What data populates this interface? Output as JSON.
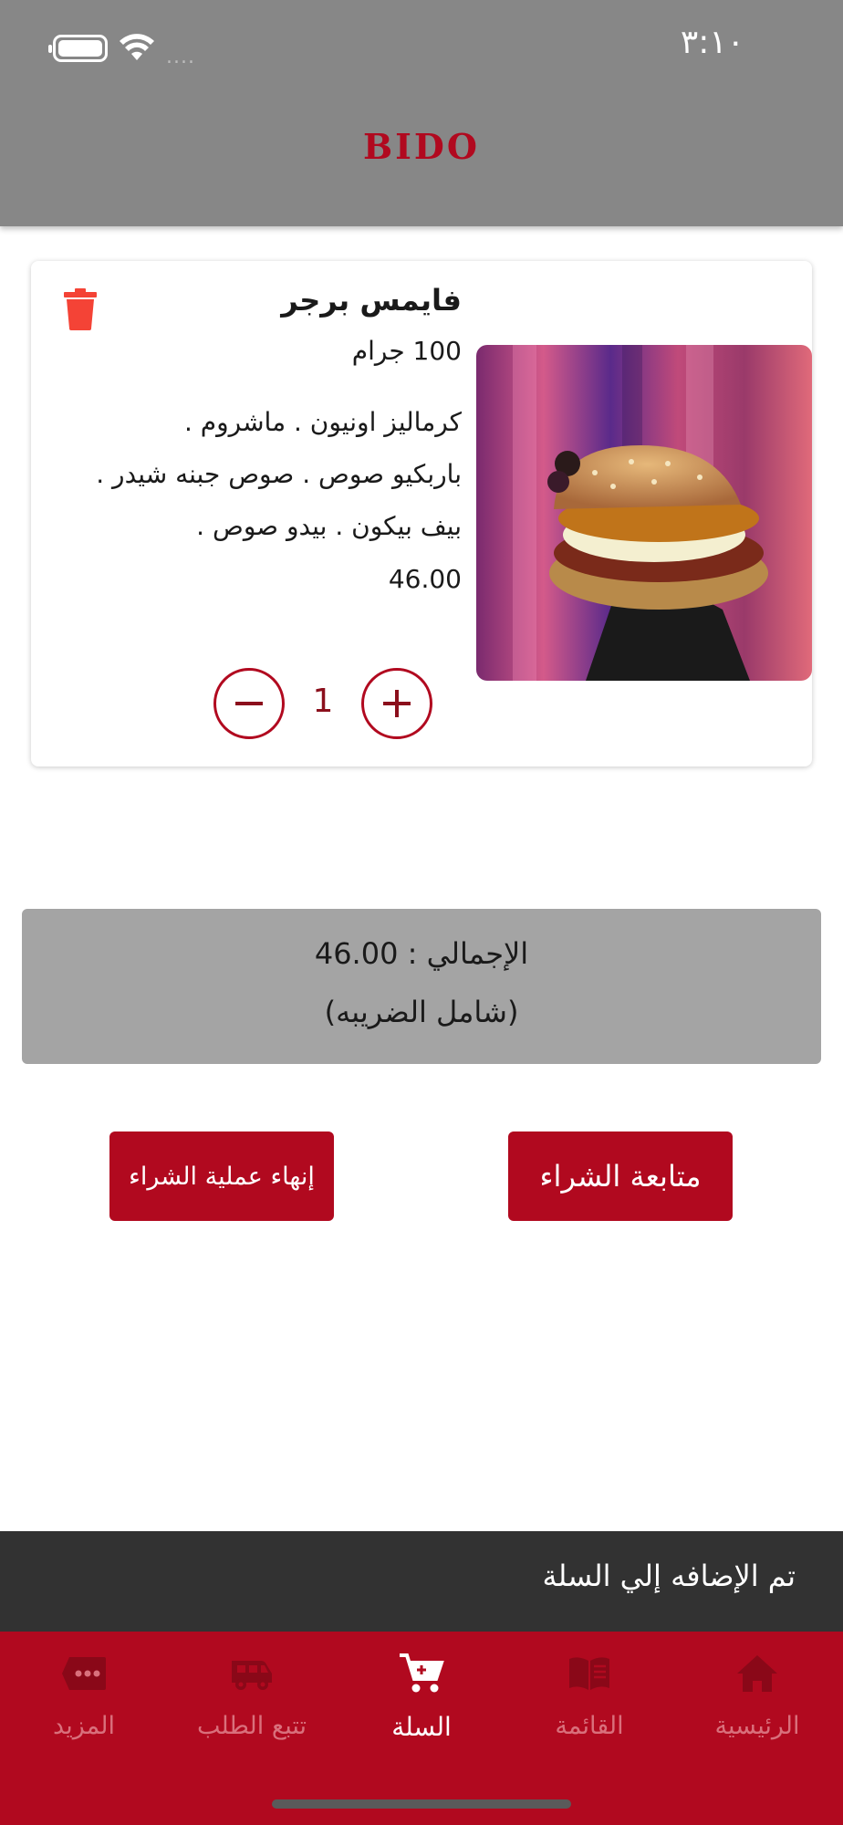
{
  "status_bar": {
    "time": "٣:١٠",
    "signal_dots": "....",
    "icons": [
      "battery-icon",
      "wifi-icon",
      "signal-icon"
    ]
  },
  "header": {
    "brand": "BIDO"
  },
  "cart": {
    "items": [
      {
        "name": "فايمس برجر",
        "weight": "100 جرام",
        "description_lines": [
          "كرماليز اونيون . ماشروم .",
          "باربكيو صوص . صوص جبنه شيدر .",
          "بيف بيكون . بيدو صوص ."
        ],
        "price": "46.00",
        "quantity": "1"
      }
    ]
  },
  "totals": {
    "total_label": "الإجمالي : 46.00",
    "tax_note": "(شامل الضريبه)"
  },
  "actions": {
    "finish_label": "إنهاء عملية الشراء",
    "continue_label": "متابعة الشراء"
  },
  "snackbar": {
    "message": "تم الإضافه إلي السلة"
  },
  "bottom_nav": {
    "items": [
      {
        "label": "المزيد",
        "icon": "more-icon",
        "active": false
      },
      {
        "label": "تتبع الطلب",
        "icon": "truck-icon",
        "active": false
      },
      {
        "label": "السلة",
        "icon": "cart-icon",
        "active": true
      },
      {
        "label": "القائمة",
        "icon": "menu-book-icon",
        "active": false
      },
      {
        "label": "الرئيسية",
        "icon": "home-icon",
        "active": false
      }
    ]
  },
  "colors": {
    "brand_red": "#b1091f",
    "header_gray": "#878787",
    "totals_gray": "#a4a4a4",
    "snackbar": "#323232",
    "trash_red": "#f44336"
  }
}
